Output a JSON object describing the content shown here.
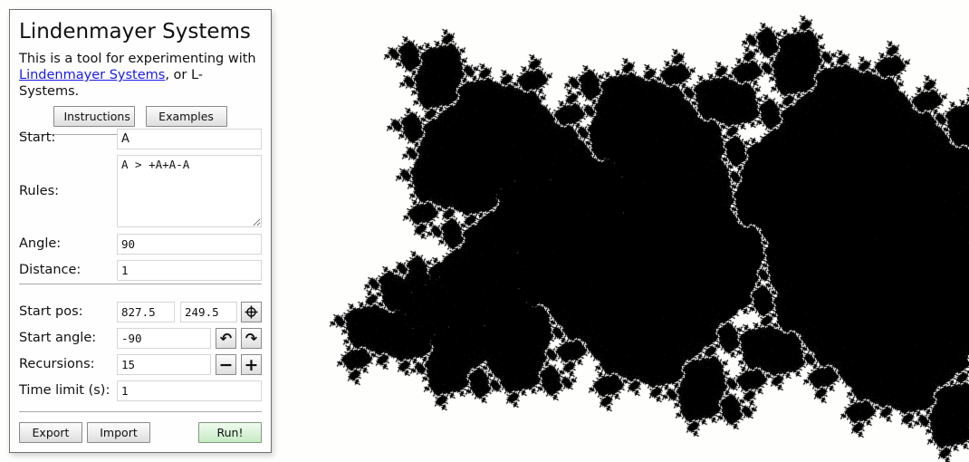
{
  "panel": {
    "title": "Lindenmayer Systems",
    "intro_text": "This is a tool for experimenting with",
    "intro_link": "Lindenmayer Systems",
    "intro_suffix": ", or L-Systems.",
    "buttons": {
      "instructions": "Instructions",
      "examples": "Examples"
    }
  },
  "form": {
    "start_label": "Start:",
    "start_value": "A",
    "rules_label": "Rules:",
    "rules_value": "A > +A+A-A",
    "angle_label": "Angle:",
    "angle_value": "90",
    "distance_label": "Distance:",
    "distance_value": "1",
    "start_pos_label": "Start pos:",
    "start_pos_x": "827.5",
    "start_pos_y": "249.5",
    "start_angle_label": "Start angle:",
    "start_angle_value": "-90",
    "recursions_label": "Recursions:",
    "recursions_value": "15",
    "time_limit_label": "Time limit (s):",
    "time_limit_value": "1"
  },
  "icons": {
    "crosshair": "⌖",
    "rotate_ccw": "↶",
    "rotate_cw": "↷",
    "minus": "−",
    "plus": "+"
  },
  "footer": {
    "export": "Export",
    "import": "Import",
    "run": "Run!"
  },
  "render": {
    "axiom": "A",
    "rules": {
      "A": "+A+A-A"
    },
    "angle_deg": 90,
    "distance": 1,
    "start": [
      827.5,
      249.5
    ],
    "start_angle_deg": -90,
    "recursions": 15,
    "stroke_color": "#000000",
    "background_color": "#fefefc"
  }
}
